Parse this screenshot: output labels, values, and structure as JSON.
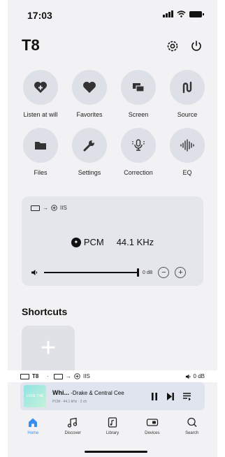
{
  "status_bar": {
    "time": "17:03"
  },
  "header": {
    "title": "T8"
  },
  "controls": [
    {
      "label": "Listen at will",
      "icon": "heart-plus-icon"
    },
    {
      "label": "Favorites",
      "icon": "heart-icon"
    },
    {
      "label": "Screen",
      "icon": "screen-icon"
    },
    {
      "label": "Source",
      "icon": "source-icon"
    },
    {
      "label": "Files",
      "icon": "folder-icon"
    },
    {
      "label": "Settings",
      "icon": "wrench-icon"
    },
    {
      "label": "Correction",
      "icon": "microphone-icon"
    },
    {
      "label": "EQ",
      "icon": "equalizer-icon"
    }
  ],
  "player_card": {
    "route": "IIS",
    "format": "PCM",
    "sample_rate": "44.1 KHz",
    "volume": "0 dB",
    "volume_level_fraction": 1.0
  },
  "shortcuts": {
    "title": "Shortcuts",
    "add_label": "+"
  },
  "mini_status": {
    "device": "T8",
    "route": "IIS",
    "volume": "0 dB"
  },
  "now_playing": {
    "art_text": "LOVE THE",
    "title": "Whi...",
    "artist": " -Drake & Central Cee",
    "detail": "PCM · 44.1 kHz · 2 ch"
  },
  "tabs": [
    {
      "label": "Home",
      "icon": "home-icon",
      "active": true
    },
    {
      "label": "Discover",
      "icon": "music-note-icon"
    },
    {
      "label": "Library",
      "icon": "library-icon"
    },
    {
      "label": "Devices",
      "icon": "device-icon"
    },
    {
      "label": "Search",
      "icon": "search-icon"
    }
  ],
  "colors": {
    "accent": "#3a8df0",
    "tile": "#dde0e6",
    "background": "#f2f2f4"
  }
}
